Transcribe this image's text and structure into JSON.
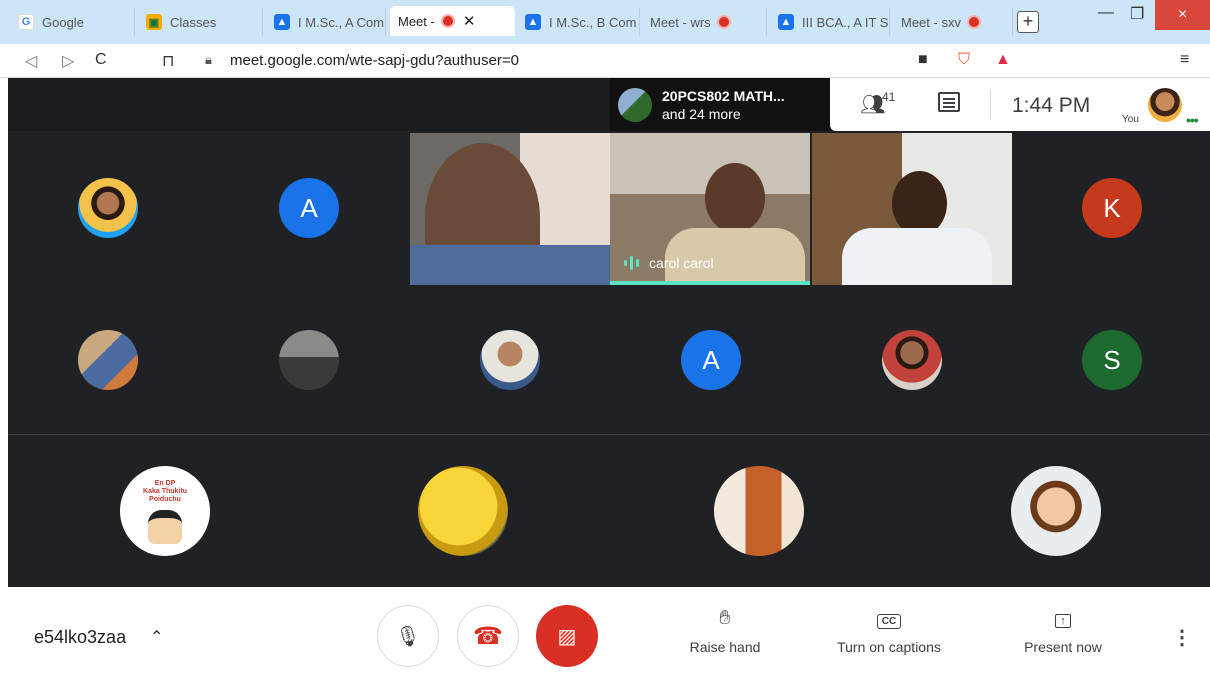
{
  "browser": {
    "tabs": [
      {
        "label": "Google",
        "favicon": "google-icon"
      },
      {
        "label": "Classes",
        "favicon": "classroom-icon"
      },
      {
        "label": "I M.Sc., A Com",
        "favicon": "user-icon"
      },
      {
        "label": "Meet -",
        "favicon": "meet-icon",
        "recording": true,
        "active": true
      },
      {
        "label": "I M.Sc., B Com",
        "favicon": "user-icon"
      },
      {
        "label": "Meet - wrs",
        "favicon": "meet-icon",
        "recording": true
      },
      {
        "label": "III BCA., A IT SI",
        "favicon": "user-icon"
      },
      {
        "label": "Meet - sxv",
        "favicon": "meet-icon",
        "recording": true
      }
    ],
    "new_tab": "+",
    "close_glyph": "×",
    "url": "meet.google.com/wte-sapj-gdu?authuser=0"
  },
  "meet": {
    "presenter": {
      "line1": "20PCS802 MATH...",
      "line2": "and 24 more"
    },
    "people_count": "41",
    "clock": "1:44 PM",
    "you_label": "You",
    "top_row_avatars": [
      {
        "letter": "",
        "color": "#1da1f2"
      },
      {
        "letter": "A",
        "color": "#1a73e8"
      },
      {
        "letter": "K",
        "color": "#c5391c"
      }
    ],
    "videos": [
      {
        "name": ""
      },
      {
        "name": "carol carol",
        "speaking": true
      },
      {
        "name": ""
      }
    ],
    "middle_row_avatars": [
      {
        "letter": "",
        "color": "#c7a67a"
      },
      {
        "letter": "",
        "color": "#6a6a6a"
      },
      {
        "letter": "",
        "color": "#e9e4dc"
      },
      {
        "letter": "A",
        "color": "#1a73e8"
      },
      {
        "letter": "",
        "color": "#b98a6a"
      },
      {
        "letter": "S",
        "color": "#1e6a2e"
      }
    ],
    "sticker_text": "En DP\nKaka Thukitu\nPoiduchu",
    "meeting_code": "e54lko3zaa",
    "actions": {
      "raise_hand": "Raise hand",
      "captions": "Turn on captions",
      "present": "Present now"
    }
  }
}
